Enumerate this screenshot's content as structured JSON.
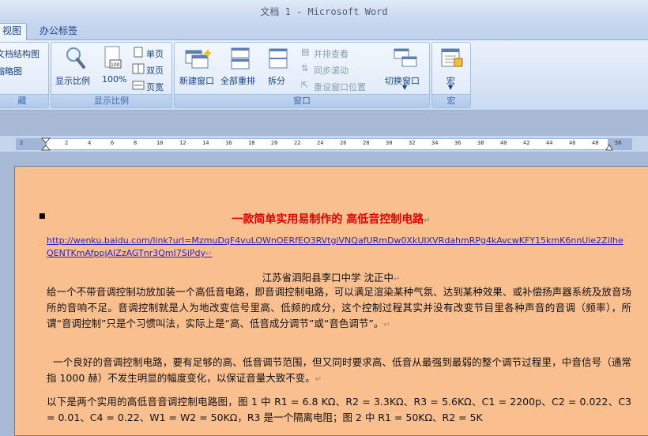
{
  "window": {
    "title": "文档 1 - Microsoft Word"
  },
  "tabs": [
    {
      "label": "视图"
    },
    {
      "label": "办公标签"
    }
  ],
  "ribbon": {
    "show_hide": {
      "item1": "文档结构图",
      "item2": "缩略图",
      "label": "藏"
    },
    "zoom": {
      "zoom_label": "显示比例",
      "hundred_label": "100%",
      "one_page": "单页",
      "two_pages": "双页",
      "page_width": "页宽",
      "label": "显示比例"
    },
    "window": {
      "new_window": "新建窗口",
      "arrange_all": "全部重排",
      "split": "拆分",
      "side_by_side": "并排查看",
      "sync_scroll": "同步滚动",
      "reset_position": "重设窗口位置",
      "switch_windows": "切换窗口",
      "label": "窗口"
    },
    "macros": {
      "macros": "宏",
      "label": "宏"
    }
  },
  "ruler": {
    "ticks": [
      "2",
      "",
      "2",
      "4",
      "6",
      "8",
      "10",
      "12",
      "14",
      "16",
      "18",
      "20",
      "22",
      "24",
      "26",
      "28",
      "30",
      "32",
      "34",
      "36",
      "38",
      "40",
      "42",
      "44",
      "46",
      "48",
      "50"
    ]
  },
  "document": {
    "title": "一款简单实用易制作的 高低音控制电路",
    "link": "http://wenku.baidu.com/link?url=MzmuDqF4vuLOWnOERfEO3RVtgiVNQafURmDw0XkUIXVRdahmRPg4kAvcwKFY15kmK6nnUie2ZiIheQENTKmAfppjAIZzAGTnr3QmI7SiPdy",
    "author": "江苏省泗阳县李口中学 沈正中",
    "para1": "给一个不带音调控制功放加装一个高低音电路，即音调控制电路，可以满足渲染某种气氛、达到某种效果、或补偿扬声器系统及放音场所的音响不足。音调控制就是人为地改变信号里高、低频的成分，这个控制过程其实并没有改变节目里各种声音的音调（频率），所谓“音调控制”只是个习惯叫法，实际上是“高、低音成分调节”或“音色调节”。",
    "para2": "一个良好的音调控制电路，要有足够的高、低音调节范围，但又同时要求高、低音从最强到最弱的整个调节过程里，中音信号（通常指 1000 赫）不发生明显的幅度变化，以保证音量大致不变。",
    "para3": "以下是两个实用的高低音音调控制电路图，图 1 中 R1 = 6.8 KΩ、R2 = 3.3KΩ、R3 = 5.6KΩ、C1 = 2200p、C2 = 0.022、C3 = 0.01、C4 = 0.22、W1 = W2 = 50KΩ，R3 是一个隔离电阻；图 2 中 R1 = 50KΩ、R2 = 5K"
  }
}
